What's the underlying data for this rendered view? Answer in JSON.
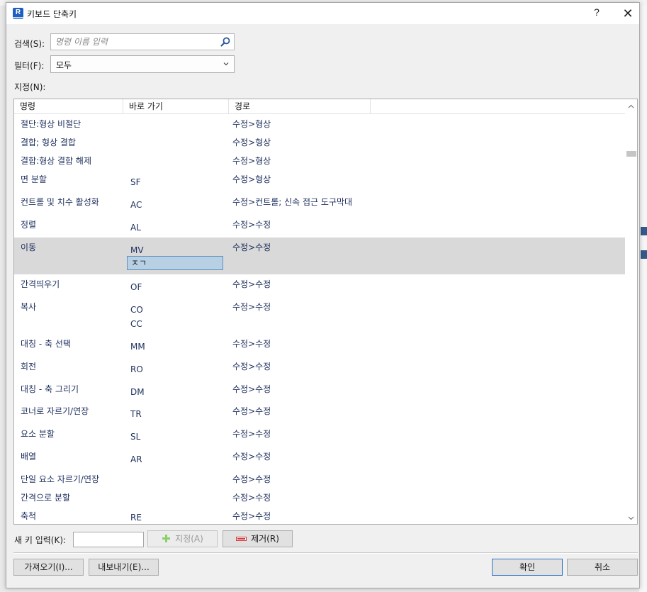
{
  "window": {
    "title": "키보드 단축키",
    "help_label": "?",
    "close_label": "✕"
  },
  "search": {
    "label": "검색(S):",
    "placeholder": "명령 이름 입력",
    "value": ""
  },
  "filter": {
    "label": "필터(F):",
    "selected": "모두"
  },
  "assignments_label": "지정(N):",
  "table": {
    "columns": [
      "명령",
      "바로 가기",
      "경로"
    ],
    "rows": [
      {
        "command": "절단:형상 비절단",
        "shortcuts": [],
        "path": "수정>형상"
      },
      {
        "command": "결합; 형상 결합",
        "shortcuts": [],
        "path": "수정>형상"
      },
      {
        "command": "결합:형상 결합 해제",
        "shortcuts": [],
        "path": "수정>형상"
      },
      {
        "command": "면 분할",
        "shortcuts": [
          "SF"
        ],
        "path": "수정>형상"
      },
      {
        "command": "컨트롤 및 치수 활성화",
        "shortcuts": [
          "AC"
        ],
        "path": "수정>컨트롤; 신속 접근 도구막대"
      },
      {
        "command": "정렬",
        "shortcuts": [
          "AL"
        ],
        "path": "수정>수정"
      },
      {
        "command": "이동",
        "shortcuts": [
          "MV"
        ],
        "editing_key": "ㅈㄱ",
        "path": "수정>수정",
        "selected": true
      },
      {
        "command": "간격띄우기",
        "shortcuts": [
          "OF"
        ],
        "path": "수정>수정"
      },
      {
        "command": "복사",
        "shortcuts": [
          "CO",
          "CC"
        ],
        "path": "수정>수정"
      },
      {
        "command": "대칭 - 축 선택",
        "shortcuts": [
          "MM"
        ],
        "path": "수정>수정"
      },
      {
        "command": "회전",
        "shortcuts": [
          "RO"
        ],
        "path": "수정>수정"
      },
      {
        "command": "대칭 - 축 그리기",
        "shortcuts": [
          "DM"
        ],
        "path": "수정>수정"
      },
      {
        "command": "코너로 자르기/연장",
        "shortcuts": [
          "TR"
        ],
        "path": "수정>수정"
      },
      {
        "command": "요소 분할",
        "shortcuts": [
          "SL"
        ],
        "path": "수정>수정"
      },
      {
        "command": "배열",
        "shortcuts": [
          "AR"
        ],
        "path": "수정>수정"
      },
      {
        "command": "단일 요소 자르기/연장",
        "shortcuts": [],
        "path": "수정>수정"
      },
      {
        "command": "간격으로 분할",
        "shortcuts": [],
        "path": "수정>수정"
      },
      {
        "command": "축척",
        "shortcuts": [
          "RE"
        ],
        "path": "수정>수정"
      }
    ]
  },
  "new_key": {
    "label": "새 키 입력(K):",
    "value": ""
  },
  "buttons": {
    "assign": "지정(A)",
    "remove": "제거(R)",
    "import": "가져오기(I)...",
    "export": "내보내기(E)...",
    "ok": "확인",
    "cancel": "취소"
  },
  "icons": {
    "search": "search-icon",
    "dropdown": "chevron-down-icon",
    "assign": "plus-icon",
    "remove": "minus-icon"
  },
  "colors": {
    "selected_row": "#d9d9d9",
    "edit_cell": "#b8d0e4",
    "app_icon": "#1f5fbf",
    "assign_plus": "#6ab04c",
    "remove_minus": "#d0393e"
  }
}
